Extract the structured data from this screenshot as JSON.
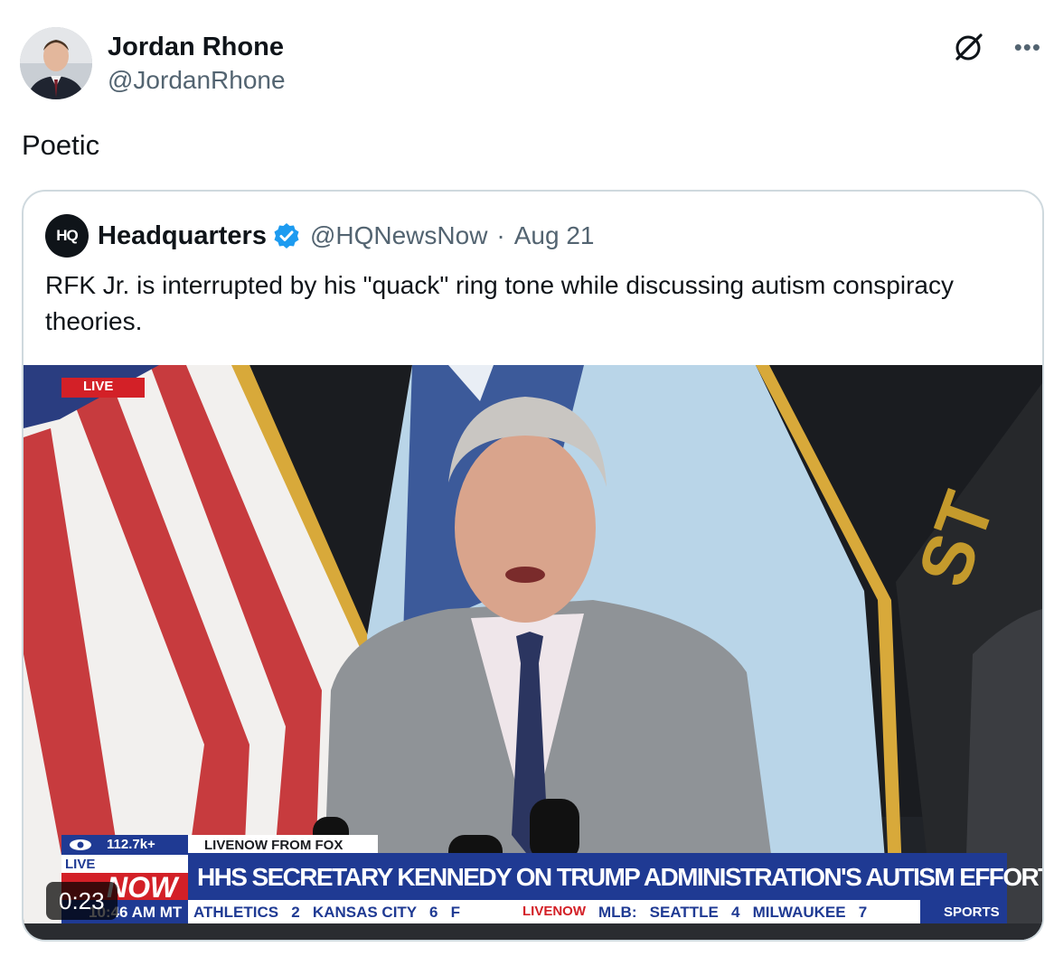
{
  "author": {
    "name": "Jordan Rhone",
    "handle": "@JordanRhone"
  },
  "tweet": {
    "text": "Poetic"
  },
  "icons": {
    "grok": "grok-icon",
    "more": "more-horizontal-icon",
    "verified": "verified-badge-icon"
  },
  "quote": {
    "logo_text": "HQ",
    "name": "Headquarters",
    "handle": "@HQNewsNow",
    "separator": "·",
    "date": "Aug 21",
    "text": "RFK Jr. is interrupted by his \"quack\" ring tone while discussing autism conspiracy theories."
  },
  "video": {
    "duration": "0:23",
    "live_badge": "LIVE",
    "viewers": "112.7k+",
    "source": "LIVENOW FROM FOX",
    "live_label": "LIVE",
    "now_label": "NOW",
    "time": "10:46 AM MT",
    "headline": "HHS SECRETARY KENNEDY ON TRUMP ADMINISTRATION'S AUTISM EFFORTS",
    "ticker": "ATHLETICS   2   KANSAS CITY   6   F",
    "ticker_brand": "LIVENOW",
    "ticker2": "MLB:   SEATTLE   4   MILWAUKEE   7",
    "ticker_tag": "SPORTS"
  },
  "colors": {
    "verified_blue": "#1d9bf0",
    "chyron_blue": "#1f3a93",
    "live_red": "#d32027"
  }
}
